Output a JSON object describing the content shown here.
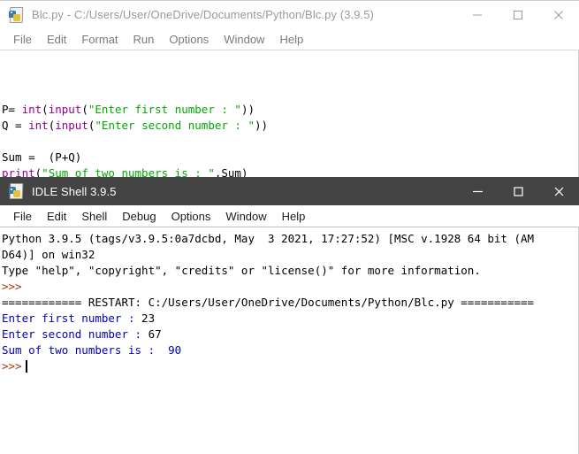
{
  "editor_window": {
    "icon": "python-file-icon",
    "title": "Blc.py - C:/Users/User/OneDrive/Documents/Python/Blc.py (3.9.5)",
    "state": "inactive",
    "controls": {
      "minimize": "minimize-button",
      "maximize": "maximize-button",
      "close": "close-button"
    },
    "menu": [
      {
        "label": "File"
      },
      {
        "label": "Edit"
      },
      {
        "label": "Format"
      },
      {
        "label": "Run"
      },
      {
        "label": "Options"
      },
      {
        "label": "Window"
      },
      {
        "label": "Help"
      }
    ],
    "code_lines": [
      [
        {
          "t": "P= ",
          "c": "plain"
        },
        {
          "t": "int",
          "c": "builtin"
        },
        {
          "t": "(",
          "c": "plain"
        },
        {
          "t": "input",
          "c": "builtin"
        },
        {
          "t": "(",
          "c": "plain"
        },
        {
          "t": "\"Enter first number : \"",
          "c": "string"
        },
        {
          "t": "))",
          "c": "plain"
        }
      ],
      [
        {
          "t": "Q = ",
          "c": "plain"
        },
        {
          "t": "int",
          "c": "builtin"
        },
        {
          "t": "(",
          "c": "plain"
        },
        {
          "t": "input",
          "c": "builtin"
        },
        {
          "t": "(",
          "c": "plain"
        },
        {
          "t": "\"Enter second number : \"",
          "c": "string"
        },
        {
          "t": "))",
          "c": "plain"
        }
      ],
      [
        {
          "t": "",
          "c": "plain"
        }
      ],
      [
        {
          "t": "Sum =  (P+Q)",
          "c": "plain"
        }
      ],
      [
        {
          "t": "print",
          "c": "builtin"
        },
        {
          "t": "(",
          "c": "plain"
        },
        {
          "t": "\"Sum of two numbers is : \"",
          "c": "string"
        },
        {
          "t": ",Sum)",
          "c": "plain"
        }
      ]
    ]
  },
  "shell_window": {
    "icon": "python-shell-icon",
    "title": "IDLE Shell 3.9.5",
    "state": "active",
    "controls": {
      "minimize": "minimize-button",
      "maximize": "maximize-button",
      "close": "close-button"
    },
    "menu": [
      {
        "label": "File"
      },
      {
        "label": "Edit"
      },
      {
        "label": "Shell"
      },
      {
        "label": "Debug"
      },
      {
        "label": "Options"
      },
      {
        "label": "Window"
      },
      {
        "label": "Help"
      }
    ],
    "output_lines": [
      [
        {
          "t": "Python 3.9.5 (tags/v3.9.5:0a7dcbd, May  3 2021, 17:27:52) [MSC v.1928 64 bit (AM",
          "c": "plain"
        }
      ],
      [
        {
          "t": "D64)] on win32",
          "c": "plain"
        }
      ],
      [
        {
          "t": "Type \"help\", \"copyright\", \"credits\" or \"license()\" for more information.",
          "c": "plain"
        }
      ],
      [
        {
          "t": ">>>",
          "c": "prompt"
        }
      ],
      [
        {
          "t": "============ RESTART: C:/Users/User/OneDrive/Documents/Python/Blc.py ===========",
          "c": "plain"
        }
      ],
      [
        {
          "t": "Enter first number : ",
          "c": "stdout"
        },
        {
          "t": "23",
          "c": "plain"
        }
      ],
      [
        {
          "t": "Enter second number : ",
          "c": "stdout"
        },
        {
          "t": "67",
          "c": "plain"
        }
      ],
      [
        {
          "t": "Sum of two numbers is :  90",
          "c": "stdout"
        }
      ]
    ],
    "prompt": ">>>"
  },
  "colors": {
    "title_active_bg": "#444444",
    "title_inactive_bg": "#ffffff",
    "builtin": "#900090",
    "string": "#00aa00",
    "stdout": "#0000bb",
    "prompt": "#aa3300"
  }
}
